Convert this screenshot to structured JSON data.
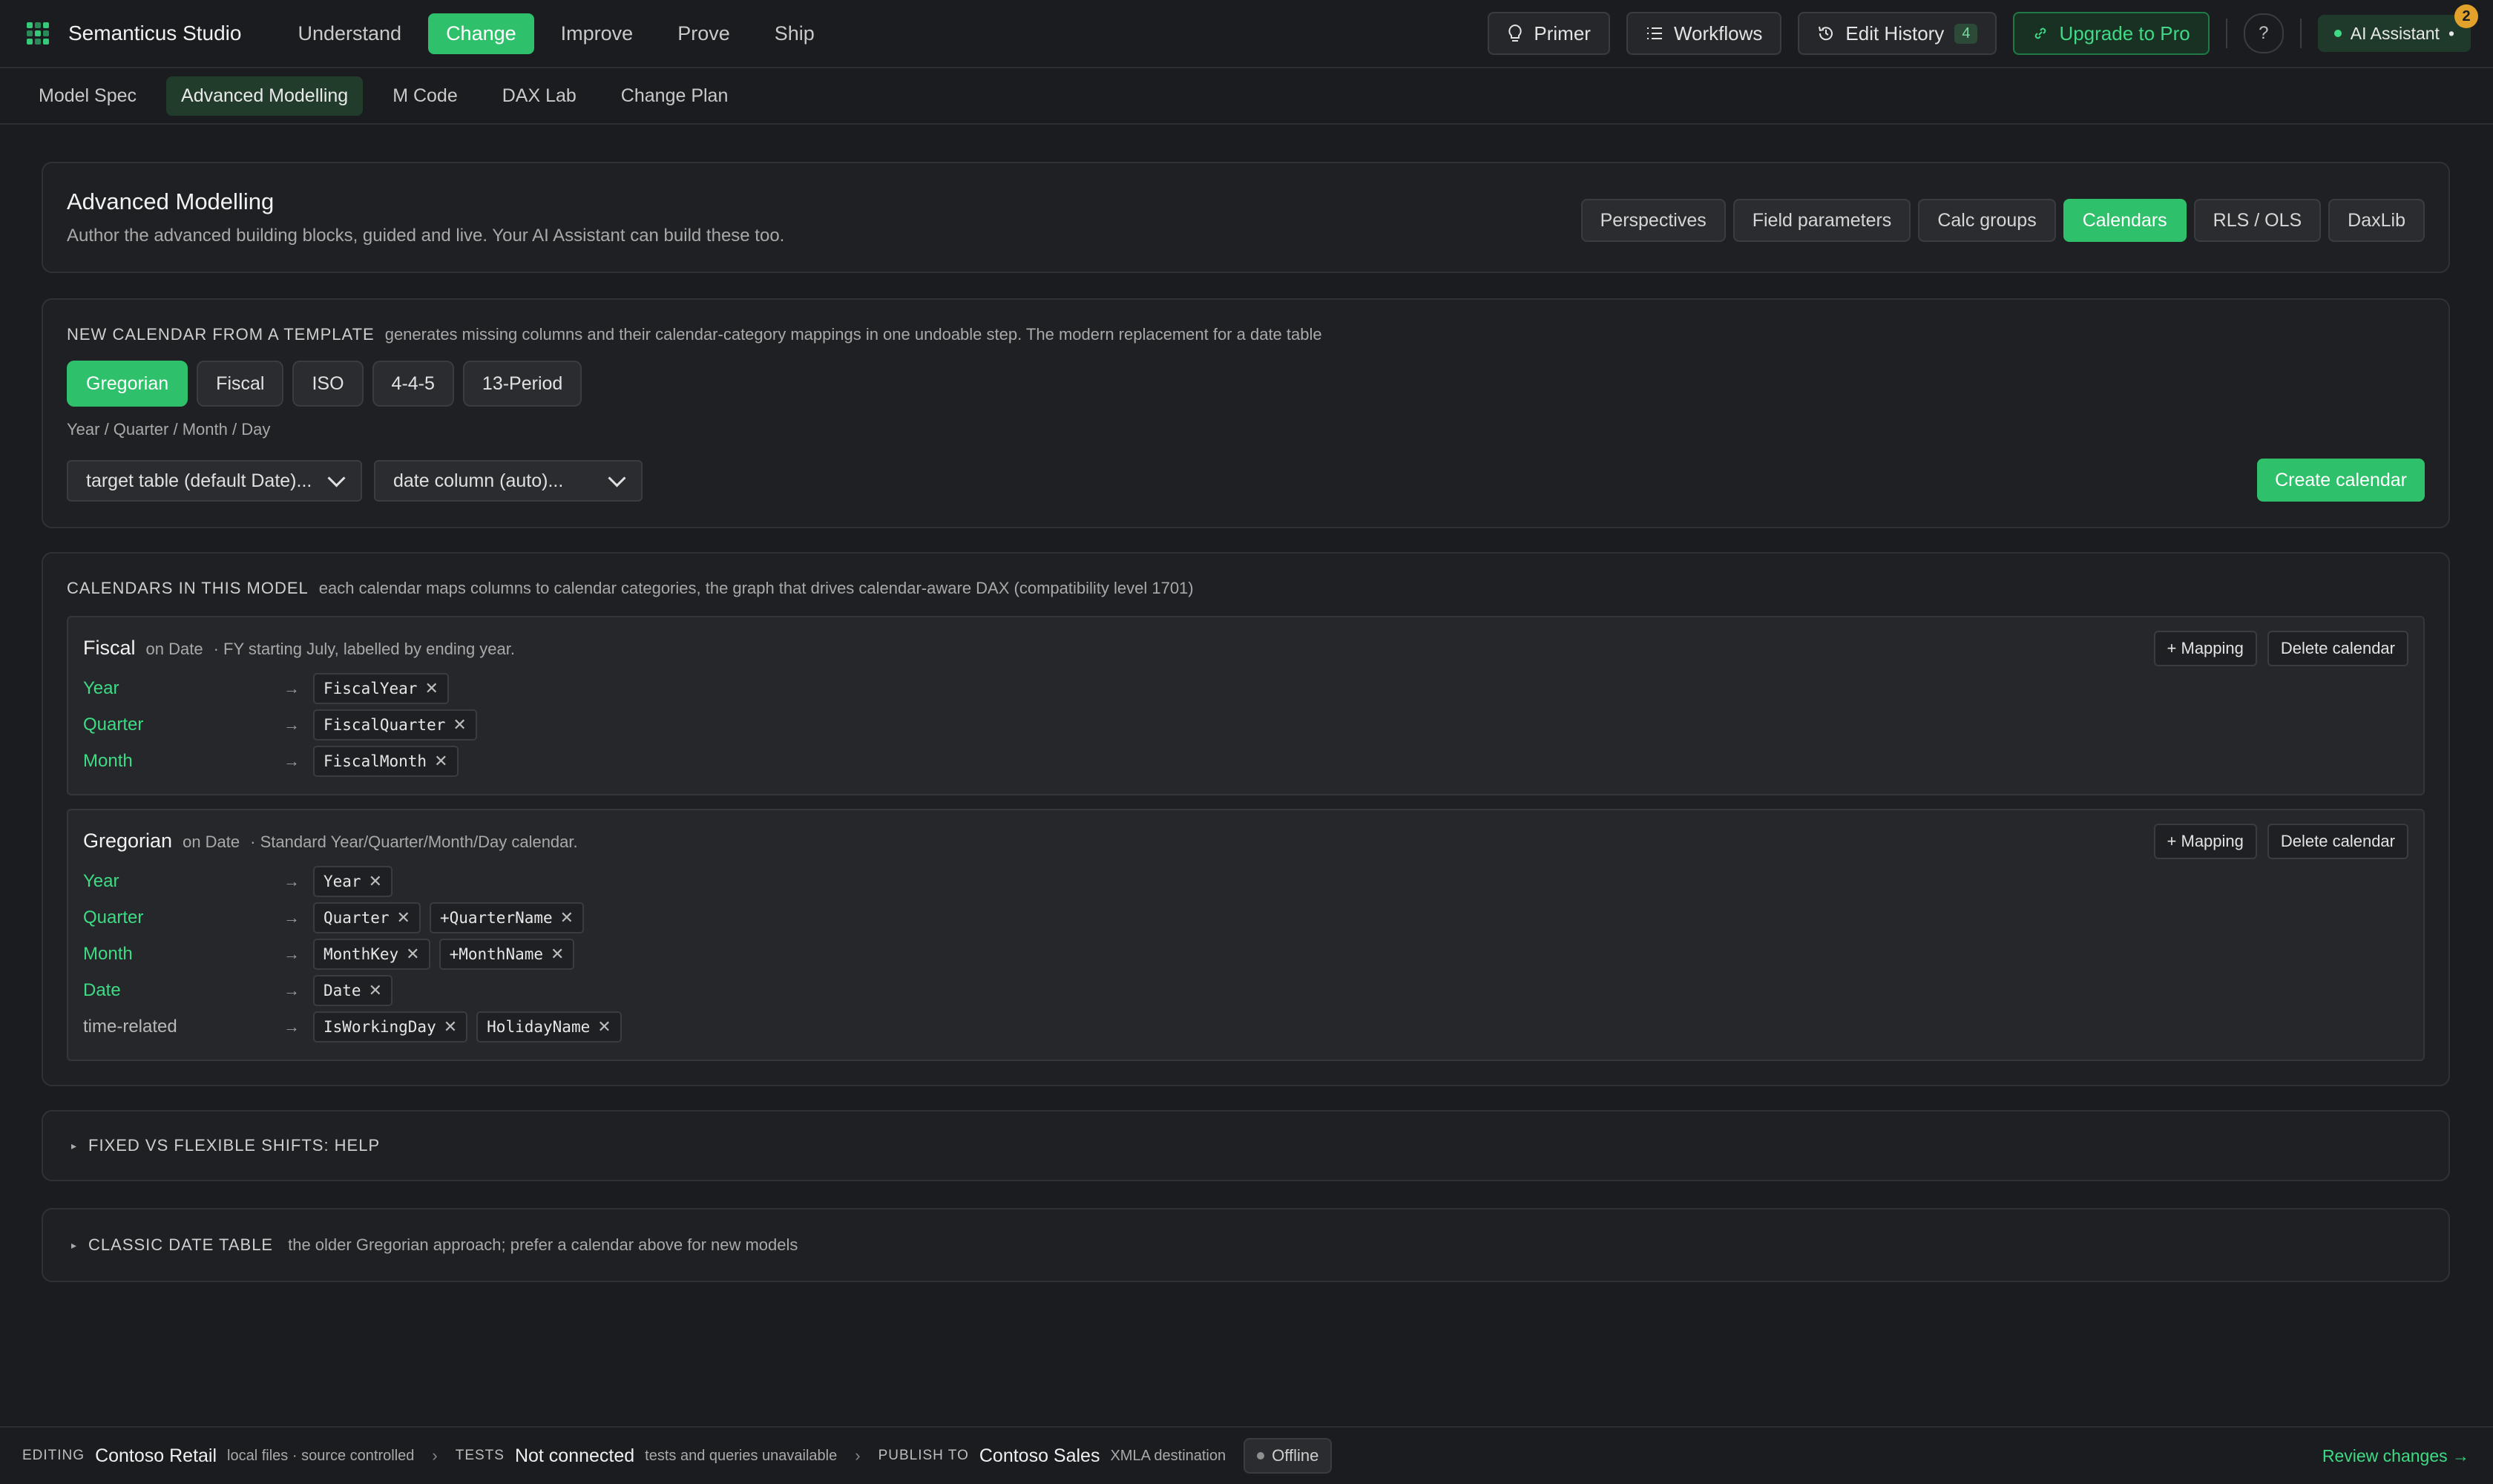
{
  "app": {
    "name": "Semanticus Studio"
  },
  "nav": [
    "Understand",
    "Change",
    "Improve",
    "Prove",
    "Ship"
  ],
  "nav_active": "Change",
  "toolbar": {
    "primer": "Primer",
    "workflows": "Workflows",
    "edit_history": "Edit History",
    "edit_history_count": "4",
    "upgrade": "Upgrade to Pro",
    "help": "?",
    "ai_assistant": "AI Assistant",
    "ai_dot": "•",
    "notifications": "2"
  },
  "subtabs": [
    "Model Spec",
    "Advanced Modelling",
    "M Code",
    "DAX Lab",
    "Change Plan"
  ],
  "header": {
    "title": "Advanced Modelling",
    "subtitle": "Author the advanced building blocks, guided and live. Your AI Assistant can build these too.",
    "pills": [
      "Perspectives",
      "Field parameters",
      "Calc groups",
      "Calendars",
      "RLS / OLS",
      "DaxLib"
    ],
    "active_pill": "Calendars"
  },
  "new_calendar": {
    "label": "NEW CALENDAR FROM A TEMPLATE",
    "note": "generates missing columns and their calendar-category mappings in one undoable step. The modern replacement for a date table",
    "templates": [
      "Gregorian",
      "Fiscal",
      "ISO",
      "4-4-5",
      "13-Period"
    ],
    "active_template": "Gregorian",
    "template_desc": "Year / Quarter / Month / Day",
    "target_table": "target table (default Date)...",
    "date_column": "date column (auto)...",
    "create": "Create calendar"
  },
  "calendars": {
    "label": "CALENDARS IN THIS MODEL",
    "note": "each calendar maps columns to calendar categories, the graph that drives calendar-aware DAX (compatibility level 1701)",
    "add_mapping": "+ Mapping",
    "delete": "Delete calendar",
    "arrow": "→",
    "remove": "✕",
    "fiscal": {
      "name": "Fiscal",
      "on": "on Date",
      "desc": "· FY starting July, labelled by ending year.",
      "rows": [
        {
          "cat": "Year",
          "cols": [
            "FiscalYear"
          ]
        },
        {
          "cat": "Quarter",
          "cols": [
            "FiscalQuarter"
          ]
        },
        {
          "cat": "Month",
          "cols": [
            "FiscalMonth"
          ]
        }
      ]
    },
    "gregorian": {
      "name": "Gregorian",
      "on": "on Date",
      "desc": "· Standard Year/Quarter/Month/Day calendar.",
      "rows": [
        {
          "cat": "Year",
          "cols": [
            "Year"
          ]
        },
        {
          "cat": "Quarter",
          "cols": [
            "Quarter",
            "+QuarterName"
          ]
        },
        {
          "cat": "Month",
          "cols": [
            "MonthKey",
            "+MonthName"
          ]
        },
        {
          "cat": "Date",
          "cols": [
            "Date"
          ]
        },
        {
          "cat": "time-related",
          "cols": [
            "IsWorkingDay",
            "HolidayName"
          ]
        }
      ]
    }
  },
  "sections": {
    "shifts": {
      "label": "FIXED VS FLEXIBLE SHIFTS: HELP"
    },
    "classic": {
      "label": "CLASSIC DATE TABLE",
      "note": "the older Gregorian approach; prefer a calendar above for new models"
    },
    "toggle": "▸"
  },
  "footer": {
    "editing_label": "EDITING",
    "editing_value": "Contoso Retail",
    "editing_note": "local files · source controlled",
    "tests_label": "TESTS",
    "tests_value": "Not connected",
    "tests_note": "tests and queries unavailable",
    "publish_label": "PUBLISH TO",
    "publish_value": "Contoso Sales",
    "publish_note": "XMLA destination",
    "status": "Offline",
    "chevron": "›",
    "review": "Review changes →"
  }
}
